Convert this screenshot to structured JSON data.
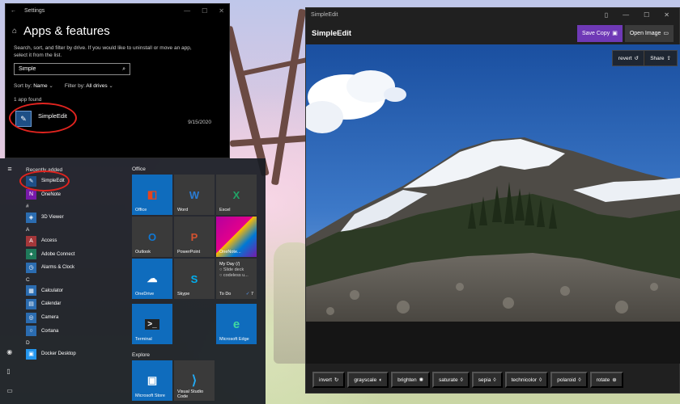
{
  "settings": {
    "window_title": "Settings",
    "title": "Apps & features",
    "description": "Search, sort, and filter by drive. If you would like to uninstall or move an app, select it from the list.",
    "search_value": "Simple",
    "sort_label": "Sort by:",
    "sort_value": "Name",
    "filter_label": "Filter by:",
    "filter_value": "All drives",
    "found_text": "1 app found",
    "app": {
      "name": "SimpleEdit",
      "date": "9/15/2020"
    }
  },
  "start_menu": {
    "recent_label": "Recently added",
    "recent": [
      {
        "name": "SimpleEdit",
        "icon": "simpleedit-icon",
        "color": "#1e4f86"
      },
      {
        "name": "OneNote",
        "icon": "onenote-icon",
        "color": "#7719aa"
      }
    ],
    "groups": [
      {
        "letter": "#",
        "apps": [
          {
            "name": "3D Viewer",
            "color": "#2b6cb0"
          }
        ]
      },
      {
        "letter": "A",
        "apps": [
          {
            "name": "Access",
            "color": "#a4373a"
          },
          {
            "name": "Adobe Connect",
            "color": "#1f7a5a"
          },
          {
            "name": "Alarms & Clock",
            "color": "#2b6cb0"
          }
        ]
      },
      {
        "letter": "C",
        "apps": [
          {
            "name": "Calculator",
            "color": "#2b6cb0"
          },
          {
            "name": "Calendar",
            "color": "#2b6cb0"
          },
          {
            "name": "Camera",
            "color": "#2b6cb0"
          },
          {
            "name": "Cortana",
            "color": "#2b6cb0"
          }
        ]
      },
      {
        "letter": "D",
        "apps": [
          {
            "name": "Docker Desktop",
            "color": "#2496ed"
          }
        ]
      }
    ],
    "office_label": "Office",
    "explore_label": "Explore",
    "office_tiles": [
      {
        "label": "Office",
        "glyph": "◧",
        "bg": "#0f6cbd",
        "fg": "#e8441c"
      },
      {
        "label": "Word",
        "glyph": "W",
        "bg": "#3a3a3a",
        "fg": "#2b7cd3"
      },
      {
        "label": "Excel",
        "glyph": "X",
        "bg": "#3a3a3a",
        "fg": "#21a366"
      },
      {
        "label": "Outlook",
        "glyph": "O",
        "bg": "#3a3a3a",
        "fg": "#0f78d4"
      },
      {
        "label": "PowerPoint",
        "glyph": "P",
        "bg": "#3a3a3a",
        "fg": "#d35230"
      },
      {
        "label": "OneNote...",
        "glyph": "",
        "bg": "#b4009e",
        "fg": "#ffffff"
      },
      {
        "label": "OneDrive",
        "glyph": "☁",
        "bg": "#0f6cbd",
        "fg": "#ffffff"
      },
      {
        "label": "Skype",
        "glyph": "S",
        "bg": "#3a3a3a",
        "fg": "#00aff0"
      }
    ],
    "myday": {
      "title": "My Day (/)",
      "items": [
        "Slide deck",
        "codeless u..."
      ],
      "footer": "To Do",
      "count": "7"
    },
    "explore_row1": [
      {
        "label": "Terminal",
        "glyph": ">_",
        "bg": "#0f6cbd",
        "fg": "#ffffff"
      },
      {
        "label": "Microsoft Edge",
        "glyph": "e",
        "bg": "#0f6cbd",
        "fg": "#40d9a0"
      }
    ],
    "explore_row2": [
      {
        "label": "Microsoft Store",
        "glyph": "▣",
        "bg": "#0f6cbd",
        "fg": "#ffffff"
      },
      {
        "label": "Visual Studio Code",
        "glyph": "⟩",
        "bg": "#3a3a3a",
        "fg": "#23a9f2"
      }
    ]
  },
  "simpleedit": {
    "window_title": "SimpleEdit",
    "app_title": "SimpleEdit",
    "save_copy": "Save Copy",
    "open_image": "Open Image",
    "revert": "revert",
    "share": "Share",
    "filters": [
      "invert",
      "grayscale",
      "brighten",
      "saturate",
      "sepia",
      "technicolor",
      "polaroid",
      "rotate"
    ]
  },
  "colors": {
    "accent": "#6f39b6",
    "highlight_ring": "#e0241f",
    "tile_blue": "#0f6cbd"
  }
}
